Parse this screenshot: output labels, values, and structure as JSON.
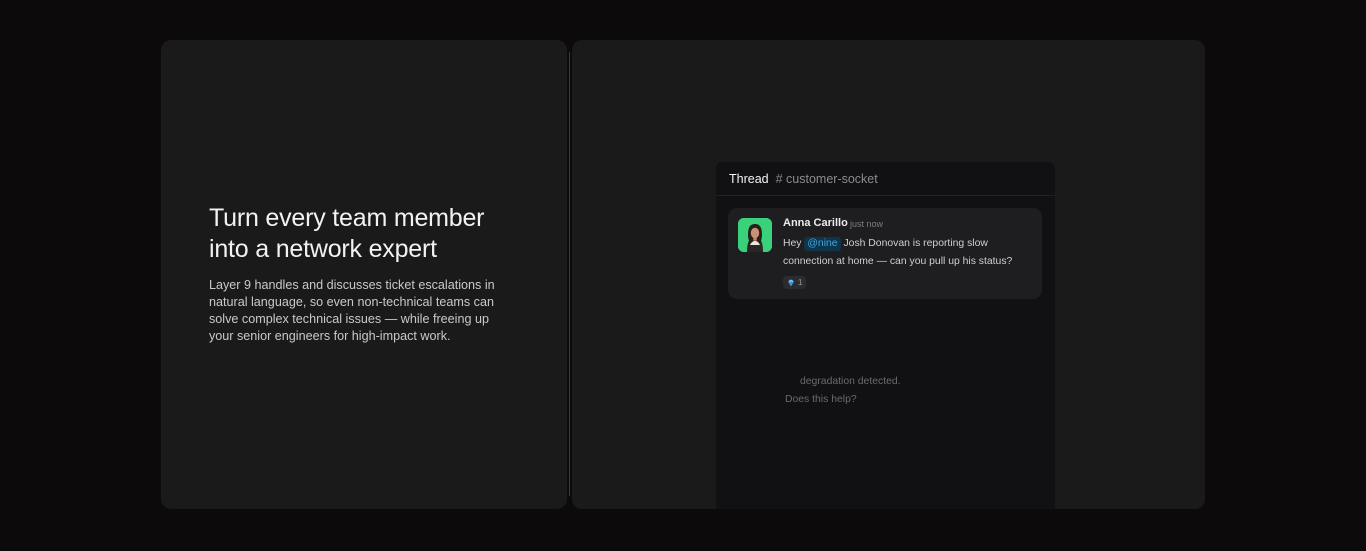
{
  "hero": {
    "headline": "Turn every team member into a network expert",
    "description": "Layer 9 handles and discusses ticket escalations in natural language, so even non-technical teams can solve complex technical issues — while freeing up your senior engineers for high-impact work."
  },
  "thread": {
    "title": "Thread",
    "channel": "# customer-socket",
    "message": {
      "author": "Anna Carillo",
      "timestamp": "just now",
      "text_prefix": "Hey",
      "mention": "@nine",
      "text_suffix": "Josh Donovan  is reporting slow connection at home — can you pull up his status?",
      "reaction_icon": "diamond-icon",
      "reaction_count": "1"
    },
    "faded_lines": [
      "degradation detected.",
      "Does this help?"
    ]
  },
  "colors": {
    "background": "#0c0a0a",
    "card": "#1b1a1b",
    "panel": "#111113",
    "avatar_bg": "#39d17a",
    "mention_text": "#3aa8e6",
    "mention_bg": "#10344a"
  }
}
